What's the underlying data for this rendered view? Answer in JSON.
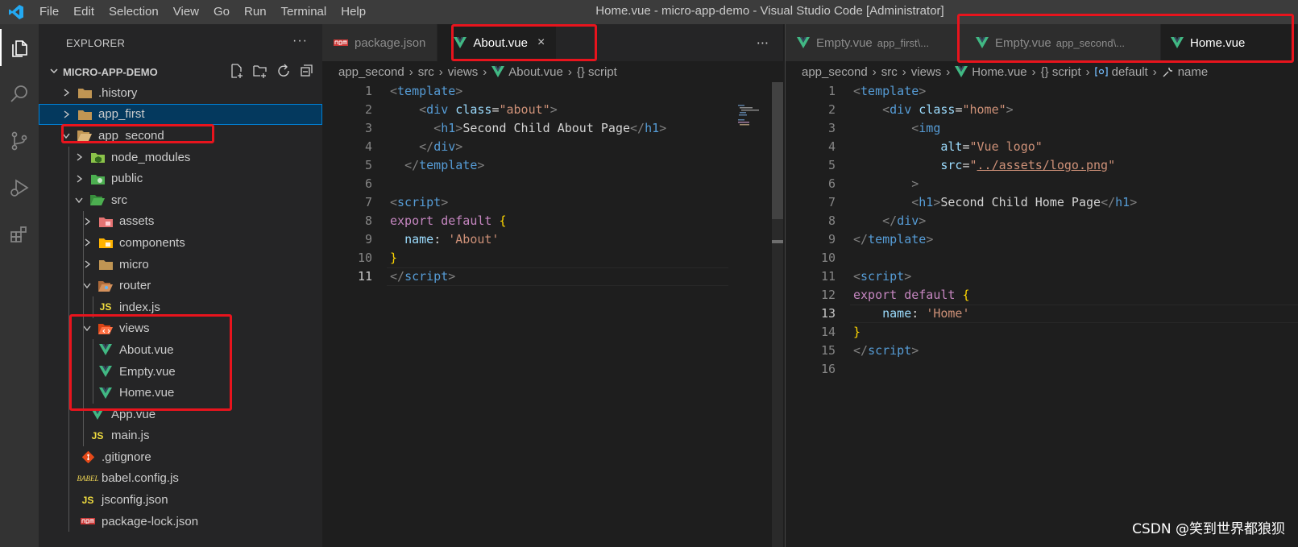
{
  "titlebar": {
    "menu": [
      "File",
      "Edit",
      "Selection",
      "View",
      "Go",
      "Run",
      "Terminal",
      "Help"
    ],
    "window_title": "Home.vue - micro-app-demo - Visual Studio Code [Administrator]"
  },
  "activitybar": {
    "items": [
      "explorer-icon",
      "search-icon",
      "source-control-icon",
      "run-debug-icon",
      "extensions-icon"
    ]
  },
  "sidebar": {
    "header": "EXPLORER",
    "more": "···",
    "root": "MICRO-APP-DEMO",
    "tree": [
      {
        "label": ".history",
        "icon": "folder"
      },
      {
        "label": "app_first",
        "icon": "folder"
      },
      {
        "label": "app_second",
        "icon": "folder-open"
      },
      {
        "label": "node_modules",
        "icon": "folder-node"
      },
      {
        "label": "public",
        "icon": "folder-public"
      },
      {
        "label": "src",
        "icon": "folder-src"
      },
      {
        "label": "assets",
        "icon": "folder-assets"
      },
      {
        "label": "components",
        "icon": "folder-components"
      },
      {
        "label": "micro",
        "icon": "folder"
      },
      {
        "label": "router",
        "icon": "folder-router"
      },
      {
        "label": "index.js",
        "icon": "js"
      },
      {
        "label": "views",
        "icon": "folder-views"
      },
      {
        "label": "About.vue",
        "icon": "vue"
      },
      {
        "label": "Empty.vue",
        "icon": "vue"
      },
      {
        "label": "Home.vue",
        "icon": "vue"
      },
      {
        "label": "App.vue",
        "icon": "vue"
      },
      {
        "label": "main.js",
        "icon": "js"
      },
      {
        "label": ".gitignore",
        "icon": "git"
      },
      {
        "label": "babel.config.js",
        "icon": "babel"
      },
      {
        "label": "jsconfig.json",
        "icon": "js"
      },
      {
        "label": "package-lock.json",
        "icon": "npm"
      }
    ]
  },
  "left_editor": {
    "tabs": [
      {
        "label": "package.json",
        "active": false
      },
      {
        "label": "About.vue",
        "active": true,
        "close": "×"
      }
    ],
    "more": "···",
    "breadcrumbs": [
      "app_second",
      "src",
      "views",
      "About.vue",
      "{} script"
    ],
    "line_numbers": [
      "1",
      "2",
      "3",
      "4",
      "5",
      "6",
      "7",
      "8",
      "9",
      "10",
      "11"
    ],
    "current_line": "11"
  },
  "right_editor": {
    "tabs": [
      {
        "label": "Empty.vue",
        "desc": "app_first\\...",
        "active": false
      },
      {
        "label": "Empty.vue",
        "desc": "app_second\\...",
        "active": false
      },
      {
        "label": "Home.vue",
        "active": true
      }
    ],
    "breadcrumbs": [
      "app_second",
      "src",
      "views",
      "Home.vue",
      "{} script",
      "default",
      "name"
    ],
    "line_numbers": [
      "1",
      "2",
      "3",
      "4",
      "5",
      "6",
      "7",
      "8",
      "9",
      "10",
      "11",
      "12",
      "13",
      "14",
      "15",
      "16"
    ],
    "current_line": "13"
  },
  "watermark": "CSDN @笑到世界都狼狈",
  "colors": {
    "highlight_box": "#e8141d",
    "selection": "#04395e",
    "vue": "#41b883"
  }
}
